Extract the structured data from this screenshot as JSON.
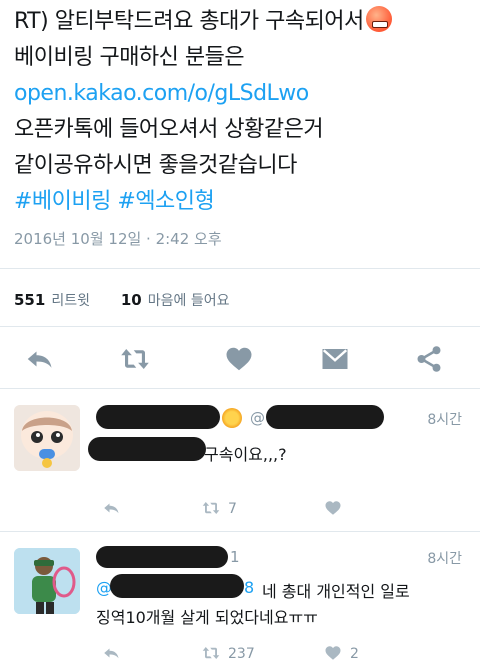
{
  "tweet": {
    "lines": [
      "RT) 알티부탁드려요 총대가 구속되어서",
      "베이비링 구매하신 분들은",
      "open.kakao.com/o/gLSdLwo",
      "오픈카톡에 들어오셔서 상황같은거",
      "같이공유하시면 좋을것같습니다",
      "#베이비링 #엑소인형"
    ],
    "timestamp": "2016년 10월 12일 · 2:42 오후",
    "retweet_count": "551",
    "retweet_label": "리트윗",
    "like_count": "10",
    "like_label": "마음에 들어요",
    "emoji_icon": "angry-face-icon"
  },
  "actions": {
    "icons": [
      "reply-icon",
      "retweet-icon",
      "heart-icon",
      "message-icon",
      "share-icon"
    ]
  },
  "replies": [
    {
      "handle_prefix": "@",
      "time": "8시간",
      "text": "구속이요,,,?",
      "retweets": "7",
      "likes": ""
    },
    {
      "handle_suffix": "1",
      "time": "8시간",
      "mention_start": "@",
      "mention_end": "8",
      "text_line1": "네 총대 개인적인 일로",
      "text_line2": "징역10개월 살게 되었다네요ㅠㅠ",
      "retweets": "237",
      "likes": "2"
    }
  ],
  "colors": {
    "link": "#1da1f2",
    "muted": "#8899a6",
    "divider": "#e1e8ed",
    "text": "#14171a"
  }
}
